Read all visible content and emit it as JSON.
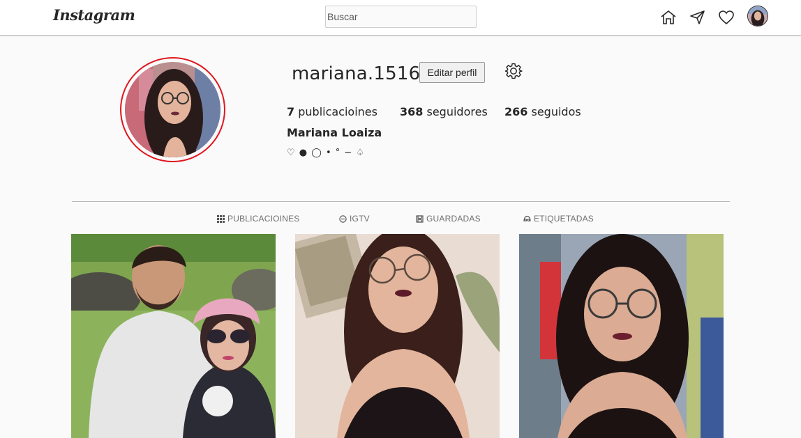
{
  "nav": {
    "logo": "Instagram",
    "search_placeholder": "Buscar",
    "icons": [
      "home-icon",
      "paper-plane-icon",
      "heart-icon",
      "avatar"
    ]
  },
  "profile": {
    "username": "mariana.1516",
    "edit_button": "Editar perfil",
    "settings_icon": "gear-icon",
    "stats": [
      {
        "count": "7",
        "label": "publicacioines"
      },
      {
        "count": "368",
        "label": "seguidores"
      },
      {
        "count": "266",
        "label": "seguidos"
      }
    ],
    "full_name": "Mariana Loaiza",
    "bio": "♡ ● ◯ • ° ~ ♤",
    "ring_color": "#e0161d"
  },
  "tabs": [
    {
      "label": "PUBLICACIOINES",
      "icon": "grid-icon"
    },
    {
      "label": "IGTV",
      "icon": "igtv-icon"
    },
    {
      "label": "GUARDADAS",
      "icon": "bookmark-icon"
    },
    {
      "label": "ETIQUETADAS",
      "icon": "tag-icon"
    }
  ],
  "posts": [
    {
      "description_icon": "photo-couple"
    },
    {
      "description_icon": "photo-selfie"
    },
    {
      "description_icon": "photo-portrait"
    }
  ]
}
